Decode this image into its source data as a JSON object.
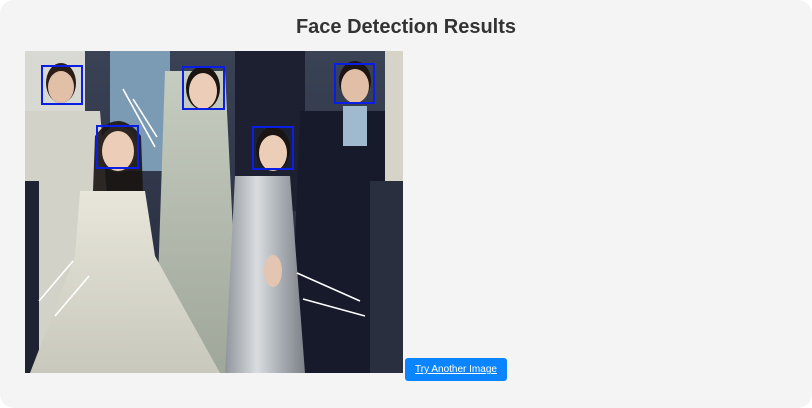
{
  "page": {
    "title": "Face Detection Results"
  },
  "actions": {
    "try_another_label": "Try Another Image"
  },
  "detections": {
    "box_color": "#0a1ee6",
    "faces": [
      {
        "name": "face-box-1"
      },
      {
        "name": "face-box-2"
      },
      {
        "name": "face-box-3"
      },
      {
        "name": "face-box-4"
      },
      {
        "name": "face-box-5"
      }
    ]
  },
  "colors": {
    "button": "#0a84ff",
    "title": "#333333",
    "background": "#f4f4f4"
  }
}
